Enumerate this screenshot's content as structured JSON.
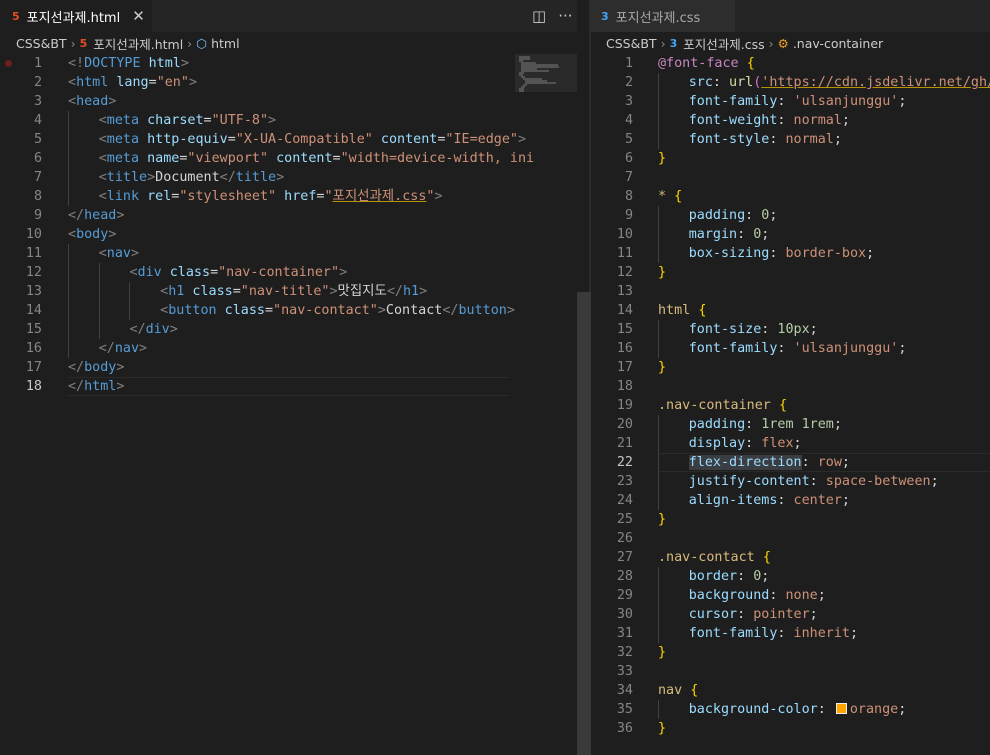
{
  "left_editor": {
    "tab": {
      "icon": "5",
      "filename": "포지선과제.html",
      "close": "✕"
    },
    "actions": {
      "split": "◫",
      "more": "···"
    },
    "breadcrumb": {
      "folder": "CSS&BT",
      "file": "포지선과제.html",
      "symbol": "html"
    },
    "lines": [
      [
        "<!",
        "DOCTYPE",
        " ",
        "html",
        ">"
      ],
      [
        "<",
        "html",
        " ",
        "lang",
        "=",
        "\"en\"",
        ">"
      ],
      [
        "<",
        "head",
        ">"
      ],
      [
        "<",
        "meta",
        " ",
        "charset",
        "=",
        "\"UTF-8\"",
        ">"
      ],
      [
        "<",
        "meta",
        " ",
        "http-equiv",
        "=",
        "\"X-UA-Compatible\"",
        " ",
        "content",
        "=",
        "\"IE=edge\"",
        ">"
      ],
      [
        "<",
        "meta",
        " ",
        "name",
        "=",
        "\"viewport\"",
        " ",
        "content",
        "=",
        "\"width=device-width, ini"
      ],
      [
        "<",
        "title",
        ">",
        "Document",
        "</",
        "title",
        ">"
      ],
      [
        "<",
        "link",
        " ",
        "rel",
        "=",
        "\"stylesheet\"",
        " ",
        "href",
        "=",
        "\"",
        "포지선과제.css",
        "\"",
        ">"
      ],
      [
        "</",
        "head",
        ">"
      ],
      [
        "<",
        "body",
        ">"
      ],
      [
        "<",
        "nav",
        ">"
      ],
      [
        "<",
        "div",
        " ",
        "class",
        "=",
        "\"nav-container\"",
        ">"
      ],
      [
        "<",
        "h1",
        " ",
        "class",
        "=",
        "\"nav-title\"",
        ">",
        "맛집지도",
        "</",
        "h1",
        ">"
      ],
      [
        "<",
        "button",
        " ",
        "class",
        "=",
        "\"nav-contact\"",
        ">",
        "Contact",
        "</",
        "button",
        ">"
      ],
      [
        "</",
        "div",
        ">"
      ],
      [
        "</",
        "nav",
        ">"
      ],
      [
        "</",
        "body",
        ">"
      ],
      [
        "</",
        "html",
        ">"
      ]
    ]
  },
  "right_editor": {
    "tab": {
      "icon": "3",
      "filename": "포지선과제.css"
    },
    "breadcrumb": {
      "folder": "CSS&BT",
      "file": "포지선과제.css",
      "symbol": ".nav-container"
    },
    "swatch_color": "#ffa500",
    "lines": [
      [
        "@font-face",
        " ",
        "{"
      ],
      [
        "src",
        ": ",
        "url",
        "(",
        "'https://cdn.jsdelivr.net/gh/p"
      ],
      [
        "font-family",
        ": ",
        "'ulsanjunggu'",
        ";"
      ],
      [
        "font-weight",
        ": ",
        "normal",
        ";"
      ],
      [
        "font-style",
        ": ",
        "normal",
        ";"
      ],
      [
        "}"
      ],
      [],
      [
        "*",
        " ",
        "{"
      ],
      [
        "padding",
        ": ",
        "0",
        ";"
      ],
      [
        "margin",
        ": ",
        "0",
        ";"
      ],
      [
        "box-sizing",
        ": ",
        "border-box",
        ";"
      ],
      [
        "}"
      ],
      [],
      [
        "html",
        " ",
        "{"
      ],
      [
        "font-size",
        ": ",
        "10px",
        ";"
      ],
      [
        "font-family",
        ": ",
        "'ulsanjunggu'",
        ";"
      ],
      [
        "}"
      ],
      [],
      [
        ".nav-container",
        " ",
        "{"
      ],
      [
        "padding",
        ": ",
        "1rem 1rem",
        ";"
      ],
      [
        "display",
        ": ",
        "flex",
        ";"
      ],
      [
        "flex-direction",
        ": ",
        "row",
        ";"
      ],
      [
        "justify-content",
        ": ",
        "space-between",
        ";"
      ],
      [
        "align-items",
        ": ",
        "center",
        ";"
      ],
      [
        "}"
      ],
      [],
      [
        ".nav-contact",
        " ",
        "{"
      ],
      [
        "border",
        ": ",
        "0",
        ";"
      ],
      [
        "background",
        ": ",
        "none",
        ";"
      ],
      [
        "cursor",
        ": ",
        "pointer",
        ";"
      ],
      [
        "font-family",
        ": ",
        "inherit",
        ";"
      ],
      [
        "}"
      ],
      [],
      [
        "nav",
        " ",
        "{"
      ],
      [
        "background-color",
        ": ",
        "orange",
        ";"
      ],
      [
        "}"
      ]
    ]
  }
}
